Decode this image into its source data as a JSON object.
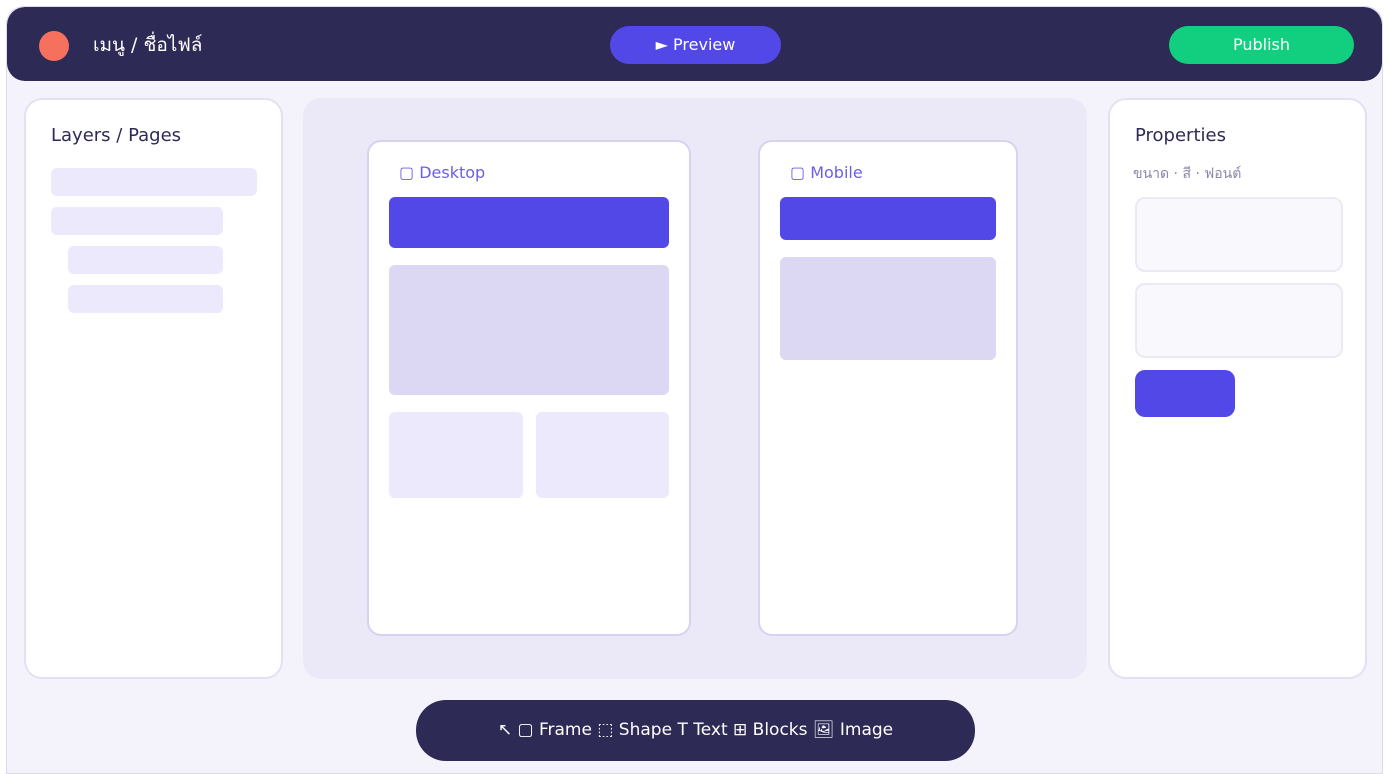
{
  "header": {
    "title": "เมนู / ชื่อไฟล์",
    "preview_label": "► Preview",
    "publish_label": "Publish"
  },
  "layers_panel": {
    "title": "Layers / Pages",
    "item_count_shown": 4
  },
  "canvas": {
    "desktop_frame_label": "▢ Desktop",
    "mobile_frame_label": "▢ Mobile"
  },
  "properties_panel": {
    "title": "Properties",
    "subtitle": "ขนาด · สี · ฟอนต์"
  },
  "toolbar": {
    "tools_label": "↖ ▢ Frame ⬚ Shape T Text ⊞ Blocks 🖼 Image"
  },
  "colors": {
    "topbar": "#2d2a55",
    "accent": "#5248e8",
    "publish": "#12cf7f",
    "status_dot": "#f6705e",
    "background": "#f4f3fc"
  }
}
